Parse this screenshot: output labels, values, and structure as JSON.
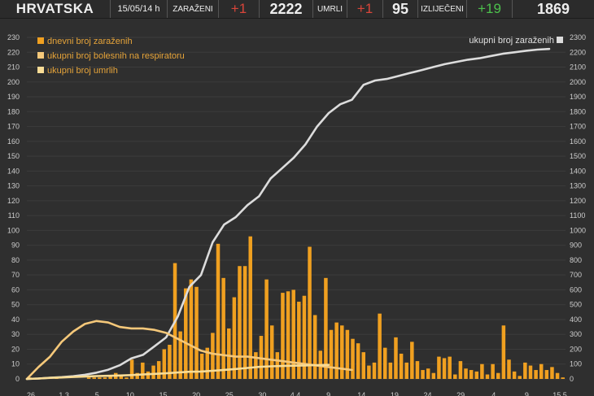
{
  "header": {
    "country": "HRVATSKA",
    "date": "15/05/14 h",
    "infected_label": "ZARAŽENI",
    "infected_delta": "+1",
    "infected_total": "2222",
    "deaths_label": "UMRLI",
    "deaths_delta": "+1",
    "deaths_total": "95",
    "recovered_label": "IZLIJEČENI",
    "recovered_delta": "+19",
    "recovered_total": "1869"
  },
  "colors": {
    "background": "#2f2f2f",
    "bars": "#f0a020",
    "line_total": "#dcdcdc",
    "line_respirator": "#f5c87a",
    "line_deaths": "#f8dc96",
    "grid": "#3c3c3c",
    "text": "#cccccc"
  },
  "chart_data": {
    "type": "bar+line",
    "grid": true,
    "legend": {
      "daily": "dnevni broj zaraženih",
      "respirator": "ukupni broj bolesnih na respiratoru",
      "deaths": "ukupni broj umrlih",
      "total": "ukupni broj zaraženih",
      "placement_left": "top-left",
      "placement_right": "top-right"
    },
    "left_axis": {
      "min": 0,
      "max": 230,
      "ticks": [
        0,
        10,
        20,
        30,
        40,
        50,
        60,
        70,
        80,
        90,
        100,
        110,
        120,
        130,
        140,
        150,
        160,
        170,
        180,
        190,
        200,
        210,
        220,
        230
      ]
    },
    "right_axis": {
      "min": 0,
      "max": 2300,
      "ticks": [
        0,
        100,
        200,
        300,
        400,
        500,
        600,
        700,
        800,
        900,
        1000,
        1100,
        1200,
        1300,
        1400,
        1500,
        1600,
        1700,
        1800,
        1900,
        2000,
        2100,
        2200,
        2300
      ]
    },
    "x_tick_labels": [
      "26",
      "1.3",
      "5",
      "10",
      "15",
      "20",
      "25",
      "30",
      "4.4",
      "9",
      "14",
      "19",
      "24",
      "29",
      "4",
      "9",
      "15.5"
    ],
    "daily_new_cases": [
      1,
      0,
      1,
      1,
      0,
      1,
      0,
      0,
      0,
      0,
      0,
      1,
      1,
      1,
      1,
      2,
      4,
      3,
      1,
      13,
      4,
      11,
      5,
      9,
      12,
      20,
      23,
      78,
      32,
      61,
      67,
      62,
      17,
      21,
      31,
      91,
      68,
      34,
      55,
      76,
      76,
      96,
      18,
      29,
      67,
      36,
      18,
      58,
      59,
      60,
      52,
      56,
      89,
      43,
      19,
      68,
      33,
      38,
      36,
      33,
      27,
      24,
      18,
      9,
      11,
      44,
      21,
      11,
      28,
      17,
      11,
      25,
      12,
      6,
      7,
      4,
      15,
      14,
      15,
      3,
      12,
      7,
      6,
      5,
      10,
      3,
      10,
      4,
      36,
      13,
      5,
      2,
      11,
      9,
      6,
      10,
      6,
      8,
      4,
      1
    ],
    "total_cases_series": [
      [
        0,
        0
      ],
      [
        10,
        3
      ],
      [
        20,
        8
      ],
      [
        30,
        12
      ],
      [
        40,
        18
      ],
      [
        50,
        28
      ],
      [
        60,
        42
      ],
      [
        70,
        62
      ],
      [
        80,
        92
      ],
      [
        90,
        138
      ],
      [
        100,
        162
      ],
      [
        110,
        220
      ],
      [
        120,
        280
      ],
      [
        130,
        420
      ],
      [
        140,
        620
      ],
      [
        150,
        700
      ],
      [
        160,
        920
      ],
      [
        170,
        1040
      ],
      [
        180,
        1090
      ],
      [
        190,
        1170
      ],
      [
        200,
        1230
      ],
      [
        210,
        1350
      ],
      [
        220,
        1420
      ],
      [
        230,
        1490
      ],
      [
        240,
        1580
      ],
      [
        250,
        1700
      ],
      [
        260,
        1790
      ],
      [
        270,
        1850
      ],
      [
        280,
        1880
      ],
      [
        290,
        1980
      ],
      [
        300,
        2010
      ],
      [
        310,
        2020
      ],
      [
        320,
        2040
      ],
      [
        330,
        2060
      ],
      [
        340,
        2080
      ],
      [
        350,
        2100
      ],
      [
        360,
        2120
      ],
      [
        370,
        2135
      ],
      [
        380,
        2150
      ],
      [
        390,
        2160
      ],
      [
        400,
        2175
      ],
      [
        410,
        2190
      ],
      [
        420,
        2200
      ],
      [
        430,
        2210
      ],
      [
        440,
        2218
      ],
      [
        450,
        2222
      ]
    ],
    "respirator_series": [
      [
        0,
        0
      ],
      [
        10,
        8
      ],
      [
        20,
        15
      ],
      [
        30,
        25
      ],
      [
        40,
        32
      ],
      [
        50,
        37
      ],
      [
        60,
        39
      ],
      [
        70,
        38
      ],
      [
        80,
        35
      ],
      [
        90,
        34
      ],
      [
        100,
        34
      ],
      [
        110,
        33
      ],
      [
        120,
        31
      ],
      [
        130,
        27
      ],
      [
        140,
        23
      ],
      [
        150,
        19
      ],
      [
        160,
        17
      ],
      [
        170,
        16
      ],
      [
        180,
        15
      ],
      [
        190,
        15
      ],
      [
        200,
        14
      ],
      [
        210,
        13
      ],
      [
        220,
        12
      ],
      [
        230,
        11
      ],
      [
        240,
        10
      ],
      [
        250,
        9
      ],
      [
        260,
        8
      ],
      [
        270,
        7
      ],
      [
        280,
        6
      ]
    ],
    "deaths_series": [
      [
        0,
        0
      ],
      [
        10,
        3
      ],
      [
        20,
        7
      ],
      [
        30,
        10
      ],
      [
        40,
        13
      ],
      [
        50,
        16
      ],
      [
        60,
        19
      ],
      [
        70,
        21
      ],
      [
        80,
        23
      ],
      [
        90,
        26
      ],
      [
        100,
        30
      ],
      [
        110,
        34
      ],
      [
        120,
        38
      ],
      [
        130,
        43
      ],
      [
        140,
        48
      ],
      [
        150,
        50
      ],
      [
        160,
        55
      ],
      [
        170,
        61
      ],
      [
        180,
        67
      ],
      [
        190,
        74
      ],
      [
        200,
        81
      ],
      [
        210,
        85
      ],
      [
        220,
        87
      ],
      [
        230,
        89
      ],
      [
        240,
        91
      ],
      [
        250,
        93
      ],
      [
        260,
        95
      ]
    ]
  }
}
